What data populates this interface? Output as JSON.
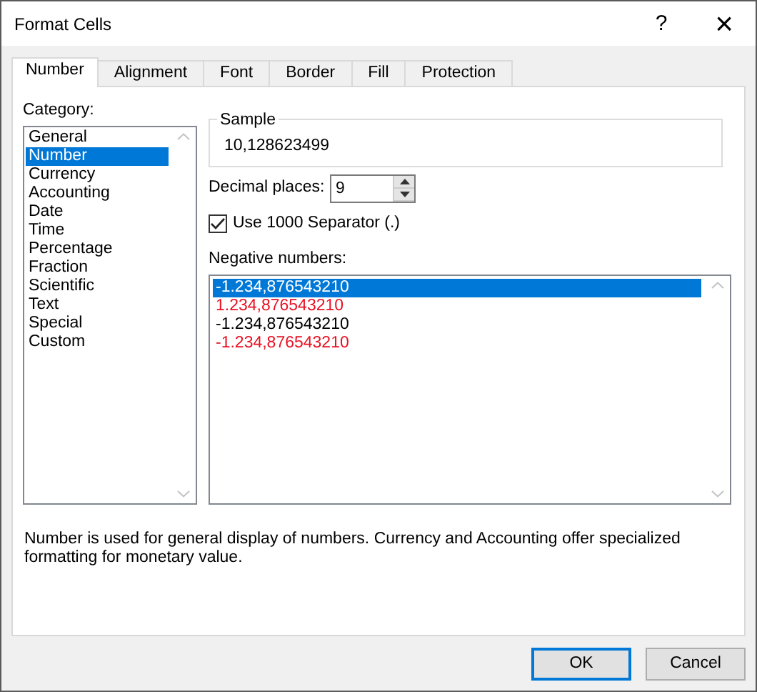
{
  "window": {
    "title": "Format Cells",
    "help": "?",
    "close": "×"
  },
  "tabs": [
    {
      "label": "Number",
      "selected": true
    },
    {
      "label": "Alignment",
      "selected": false
    },
    {
      "label": "Font",
      "selected": false
    },
    {
      "label": "Border",
      "selected": false
    },
    {
      "label": "Fill",
      "selected": false
    },
    {
      "label": "Protection",
      "selected": false
    }
  ],
  "category": {
    "label": "Category:",
    "items": [
      {
        "label": "General",
        "selected": false
      },
      {
        "label": "Number",
        "selected": true
      },
      {
        "label": "Currency",
        "selected": false
      },
      {
        "label": "Accounting",
        "selected": false
      },
      {
        "label": "Date",
        "selected": false
      },
      {
        "label": "Time",
        "selected": false
      },
      {
        "label": "Percentage",
        "selected": false
      },
      {
        "label": "Fraction",
        "selected": false
      },
      {
        "label": "Scientific",
        "selected": false
      },
      {
        "label": "Text",
        "selected": false
      },
      {
        "label": "Special",
        "selected": false
      },
      {
        "label": "Custom",
        "selected": false
      }
    ]
  },
  "sample": {
    "legend": "Sample",
    "value": "10,128623499"
  },
  "decimal_places": {
    "label": "Decimal places:",
    "value": "9"
  },
  "separator": {
    "label": "Use 1000 Separator (.)",
    "checked": true
  },
  "negative_numbers": {
    "label": "Negative numbers:",
    "items": [
      {
        "label": "-1.234,876543210",
        "selected": true
      },
      {
        "label": "1.234,876543210",
        "color": "#e81123",
        "selected": false
      },
      {
        "label": "-1.234,876543210",
        "color": "#000000",
        "selected": false
      },
      {
        "label": "-1.234,876543210",
        "color": "#e81123",
        "selected": false
      }
    ]
  },
  "description": "Number is used for general display of numbers.  Currency and Accounting offer specialized formatting for monetary value.",
  "buttons": [
    {
      "label": "OK",
      "default": true
    },
    {
      "label": "Cancel",
      "default": false
    }
  ]
}
